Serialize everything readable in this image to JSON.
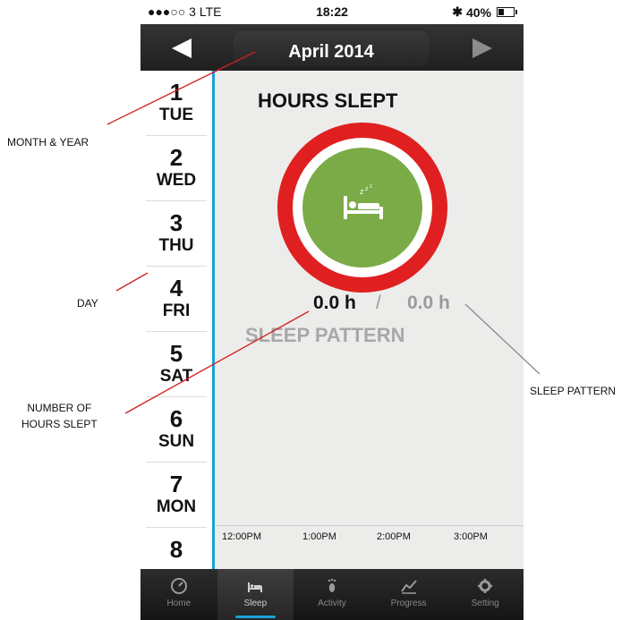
{
  "status_bar": {
    "carrier": "●●●○○ 3  LTE",
    "time": "18:22",
    "bluetooth": "✱",
    "battery": "40%",
    "battery_level": 0.4
  },
  "header": {
    "title": "April 2014",
    "prev_icon": "triangle-left-icon",
    "next_icon": "triangle-right-icon"
  },
  "days": [
    {
      "num": "1",
      "weekday": "TUE"
    },
    {
      "num": "2",
      "weekday": "WED"
    },
    {
      "num": "3",
      "weekday": "THU"
    },
    {
      "num": "4",
      "weekday": "FRI"
    },
    {
      "num": "5",
      "weekday": "SAT"
    },
    {
      "num": "6",
      "weekday": "SUN"
    },
    {
      "num": "7",
      "weekday": "MON"
    },
    {
      "num": "8",
      "weekday": ""
    }
  ],
  "main": {
    "title": "HOURS SLEPT",
    "hours_actual": "0.0 h",
    "separator": "/",
    "hours_goal": "0.0 h",
    "pattern_title": "SLEEP PATTERN",
    "timeline": [
      "12:00PM",
      "1:00PM",
      "2:00PM",
      "3:00PM"
    ],
    "colors": {
      "ring": "#e02020",
      "center": "#7aab47",
      "accent": "#1aa0d8"
    }
  },
  "tabs": [
    {
      "label": "Home",
      "icon": "gauge-icon"
    },
    {
      "label": "Sleep",
      "icon": "bed-icon",
      "active": true
    },
    {
      "label": "Activity",
      "icon": "footprint-icon"
    },
    {
      "label": "Progress",
      "icon": "line-chart-icon"
    },
    {
      "label": "Setting",
      "icon": "gear-icon"
    }
  ],
  "annotations": {
    "month_year": "MONTH & YEAR",
    "day": "DAY",
    "hours_slept_line1": "NUMBER OF",
    "hours_slept_line2": "HOURS SLEPT",
    "sleep_pattern": "SLEEP PATTERN"
  }
}
